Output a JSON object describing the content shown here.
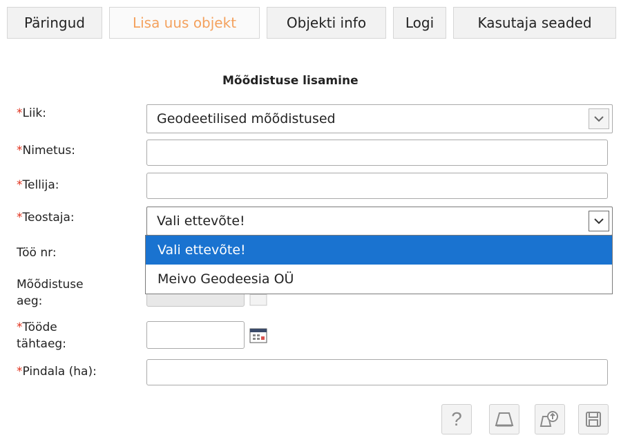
{
  "tabs": [
    {
      "label": "Päringud",
      "active": false
    },
    {
      "label": "Lisa uus objekt",
      "active": true
    },
    {
      "label": "Objekti info",
      "active": false
    },
    {
      "label": "Logi",
      "active": false
    },
    {
      "label": "Kasutaja seaded",
      "active": false
    }
  ],
  "form": {
    "title": "Mõõdistuse lisamine",
    "required_mark": "*",
    "fields": {
      "liik": {
        "label": "Liik:",
        "value": "Geodeetilised mõõdistused"
      },
      "nimetus": {
        "label": "Nimetus:",
        "value": ""
      },
      "tellija": {
        "label": "Tellija:",
        "value": ""
      },
      "teostaja": {
        "label": "Teostaja:",
        "value": "Vali ettevõte!",
        "options": [
          "Vali ettevõte!",
          "Meivo Geodeesia OÜ"
        ],
        "highlighted_option": "Vali ettevõte!"
      },
      "too_nr": {
        "label": "Töö nr:"
      },
      "moodistuse_aeg": {
        "label_line1": "Mõõdistuse",
        "label_line2": "aeg:"
      },
      "toode_tahtaeg": {
        "label_line1": "Tööde",
        "label_line2": "tähtaeg:",
        "value": ""
      },
      "pindala": {
        "label": "Pindala (ha):",
        "value": ""
      }
    }
  },
  "toolbar": {
    "help_label": "?",
    "icons": [
      "help-icon",
      "shape-icon",
      "zoom-to-shape-icon",
      "save-icon"
    ]
  },
  "colors": {
    "accent_tab": "#f4a15d",
    "required": "#e0311c",
    "selection": "#1a73d0"
  }
}
